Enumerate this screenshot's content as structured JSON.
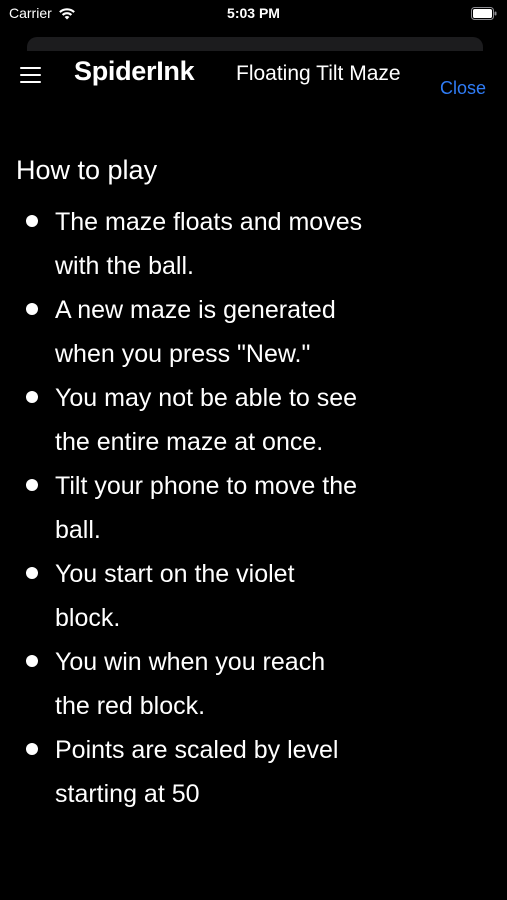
{
  "status_bar": {
    "carrier": "Carrier",
    "time": "5:03 PM"
  },
  "nav": {
    "brand": "SpiderInk",
    "title": "Floating Tilt Maze",
    "close_label": "Close",
    "accent_color": "#2f7cf6"
  },
  "content": {
    "heading": "How to play",
    "rules": [
      "The maze floats and moves with the ball.",
      "A new maze is generated when you press \"New.\"",
      "You may not be able to see the entire maze at once.",
      "Tilt your phone to move the ball.",
      "You start on the violet block.",
      "You win when you reach the red block.",
      "Points are scaled by level starting at 50"
    ]
  }
}
